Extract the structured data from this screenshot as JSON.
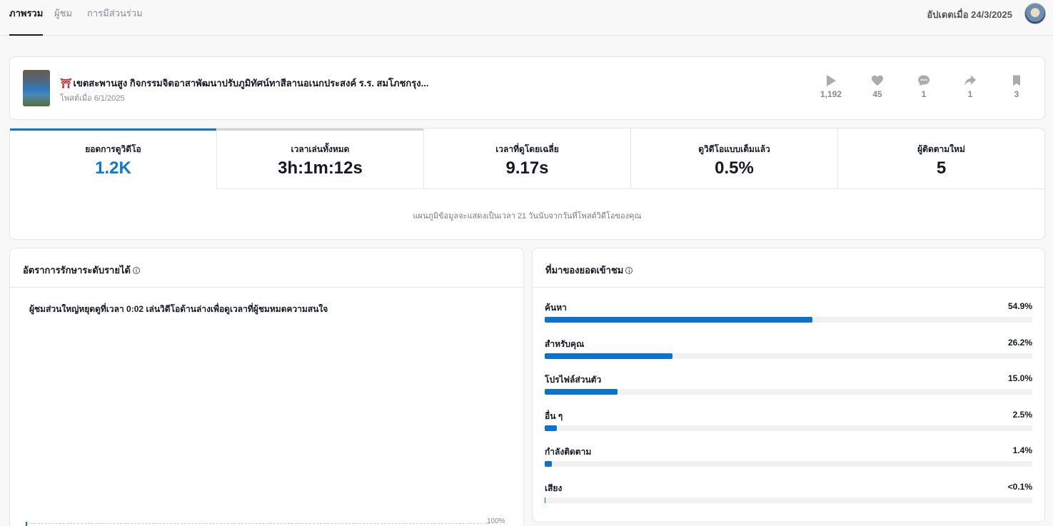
{
  "nav": {
    "tabs": [
      {
        "label": "ภาพรวม",
        "active": true
      },
      {
        "label": "ผู้ชม",
        "active": false
      },
      {
        "label": "การมีส่วนร่วม",
        "active": false
      }
    ],
    "updated": "อัปเดตเมื่อ 24/3/2025"
  },
  "video": {
    "title": "เขตสะพานสูง กิจกรรมจิตอาสาพัฒนาปรับภูมิทัศน์ทาสีลานอเนกประสงค์ ร.ร. สมโภชกรุง...",
    "title_emoji": "⛩",
    "posted": "โพสต์เมื่อ 6/1/2025",
    "stats": {
      "views": "1,192",
      "likes": "45",
      "comments": "1",
      "shares": "1",
      "saves": "3"
    }
  },
  "metrics": {
    "items": [
      {
        "label": "ยอดการดูวิดีโอ",
        "value": "1.2K"
      },
      {
        "label": "เวลาเล่นทั้งหมด",
        "value": "3h:1m:12s"
      },
      {
        "label": "เวลาที่ดูโดยเฉลี่ย",
        "value": "9.17s"
      },
      {
        "label": "ดูวิดีโอแบบเต็มแล้ว",
        "value": "0.5%"
      },
      {
        "label": "ผู้ติดตามใหม่",
        "value": "5"
      }
    ],
    "note": "แผนภูมิข้อมูลจะแสดงเป็นเวลา 21 วันนับจากวันที่โพสต์วิดีโอของคุณ"
  },
  "retention": {
    "title": "อัตราการรักษาระดับรายได้",
    "summary": "ผู้ชมส่วนใหญ่หยุดดูที่เวลา 0:02 เล่นวิดีโอด้านล่างเพื่อดูเวลาที่ผู้ชมหมดความสนใจ",
    "axis_top_label": "100%"
  },
  "traffic": {
    "title": "ที่มาของยอดเข้าชม",
    "sources": [
      {
        "name": "ค้นหา",
        "pct": "54.9%",
        "value": 54.9
      },
      {
        "name": "สำหรับคุณ",
        "pct": "26.2%",
        "value": 26.2
      },
      {
        "name": "โปรไฟล์ส่วนตัว",
        "pct": "15.0%",
        "value": 15.0
      },
      {
        "name": "อื่น ๆ",
        "pct": "2.5%",
        "value": 2.5
      },
      {
        "name": "กำลังติดตาม",
        "pct": "1.4%",
        "value": 1.4
      },
      {
        "name": "เสียง",
        "pct": "<0.1%",
        "value": 0.05
      }
    ]
  },
  "colors": {
    "accent": "#0b79d0",
    "bar": "#0b72d0",
    "track": "#f1f1f2",
    "stat_icon": "#a9abb2"
  }
}
